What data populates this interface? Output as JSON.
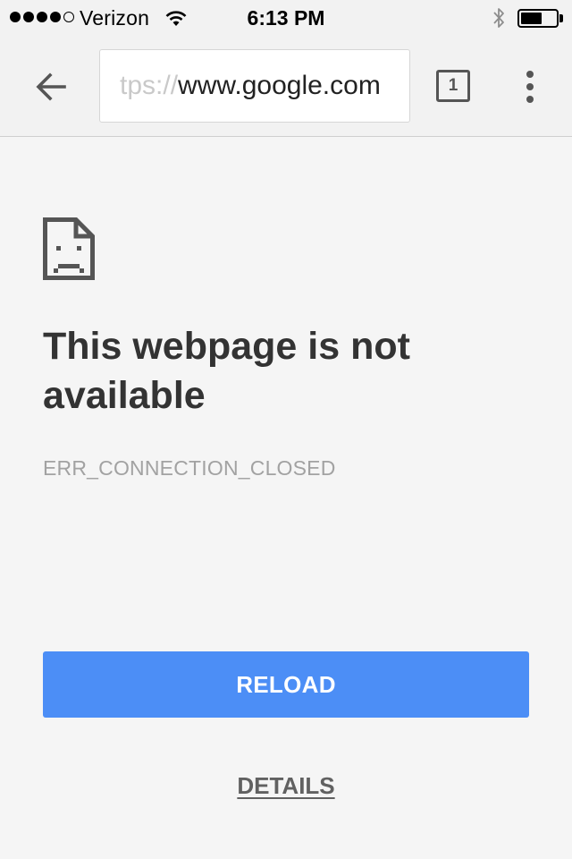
{
  "status_bar": {
    "signal_bars_filled": 4,
    "signal_bars_total": 5,
    "carrier": "Verizon",
    "time": "6:13 PM",
    "wifi_icon": "wifi-icon",
    "bluetooth_icon": "bluetooth-icon",
    "battery_level": 0.6
  },
  "toolbar": {
    "back_icon": "arrow-left-icon",
    "url_faded": "tps://",
    "url_main": "www.google.com",
    "tab_count": "1",
    "menu_icon": "more-vertical-icon"
  },
  "content": {
    "error_icon": "sad-document-icon",
    "heading": "This webpage is not available",
    "error_code": "ERR_CONNECTION_CLOSED",
    "reload_label": "RELOAD",
    "details_label": "DETAILS"
  },
  "colors": {
    "accent": "#4c8ef6",
    "heading_text": "#333333",
    "error_code_text": "#a2a2a2",
    "background": "#f5f5f5"
  }
}
